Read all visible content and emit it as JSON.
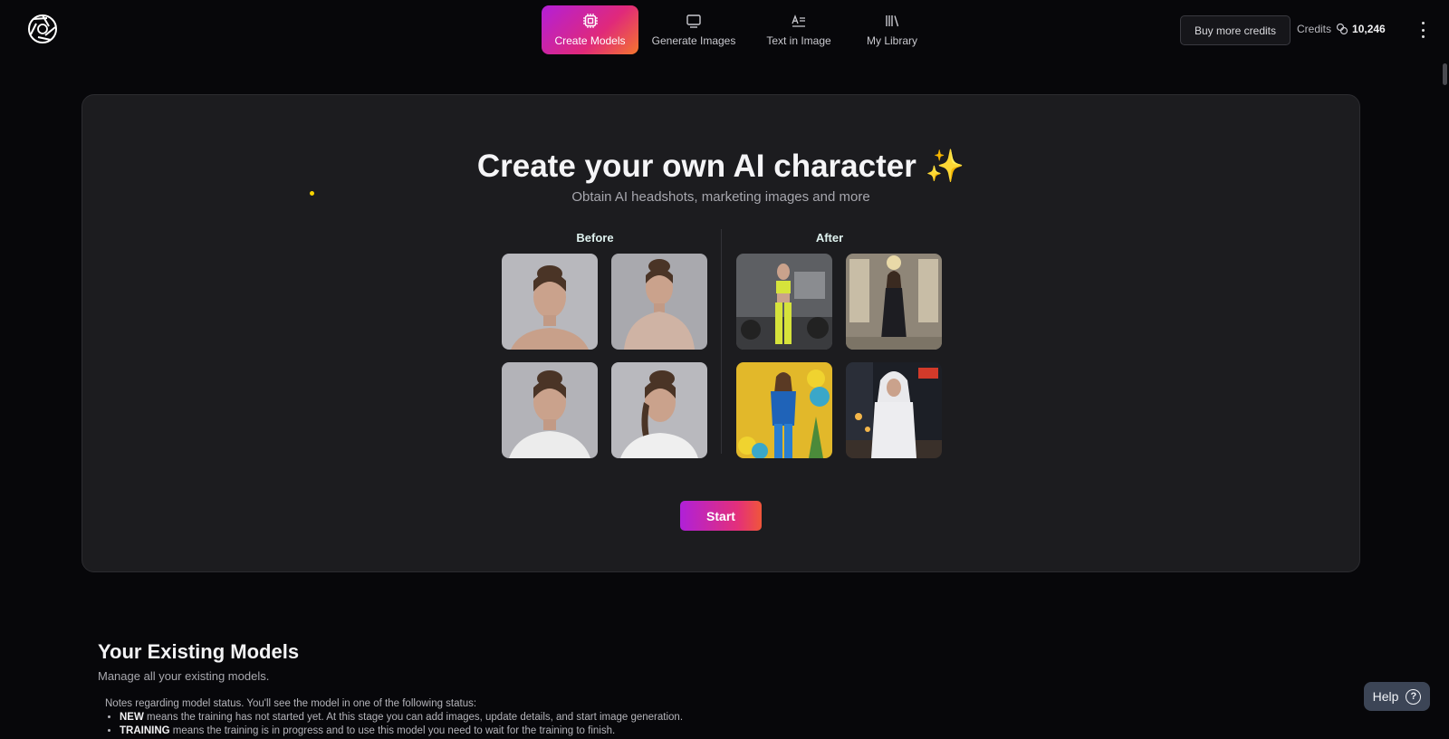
{
  "nav": {
    "items": [
      {
        "label": "Create Models",
        "icon": "chip-icon",
        "active": true
      },
      {
        "label": "Generate Images",
        "icon": "image-frame-icon",
        "active": false
      },
      {
        "label": "Text in Image",
        "icon": "text-image-icon",
        "active": false
      },
      {
        "label": "My Library",
        "icon": "library-icon",
        "active": false
      }
    ]
  },
  "header": {
    "buy_credits_label": "Buy more credits",
    "credits_label": "Credits",
    "credits_value": "10,246"
  },
  "hero": {
    "title": "Create your own AI character ✨",
    "subtitle": "Obtain AI headshots, marketing images and more",
    "before_label": "Before",
    "after_label": "After",
    "start_label": "Start"
  },
  "models": {
    "title": "Your Existing Models",
    "subtitle": "Manage all your existing models.",
    "notes_intro": "Notes regarding model status. You'll see the model in one of the following status:",
    "statuses": [
      {
        "name": "NEW",
        "desc": "means the training has not started yet. At this stage you can add images, update details, and start image generation."
      },
      {
        "name": "TRAINING",
        "desc": "means the training is in progress and to use this model you need to wait for the training to finish."
      }
    ]
  },
  "help": {
    "label": "Help"
  },
  "colors": {
    "accent_start": "#b31fd8",
    "accent_mid": "#e0297a",
    "accent_end": "#f4762d",
    "panel": "#1c1c1f"
  }
}
